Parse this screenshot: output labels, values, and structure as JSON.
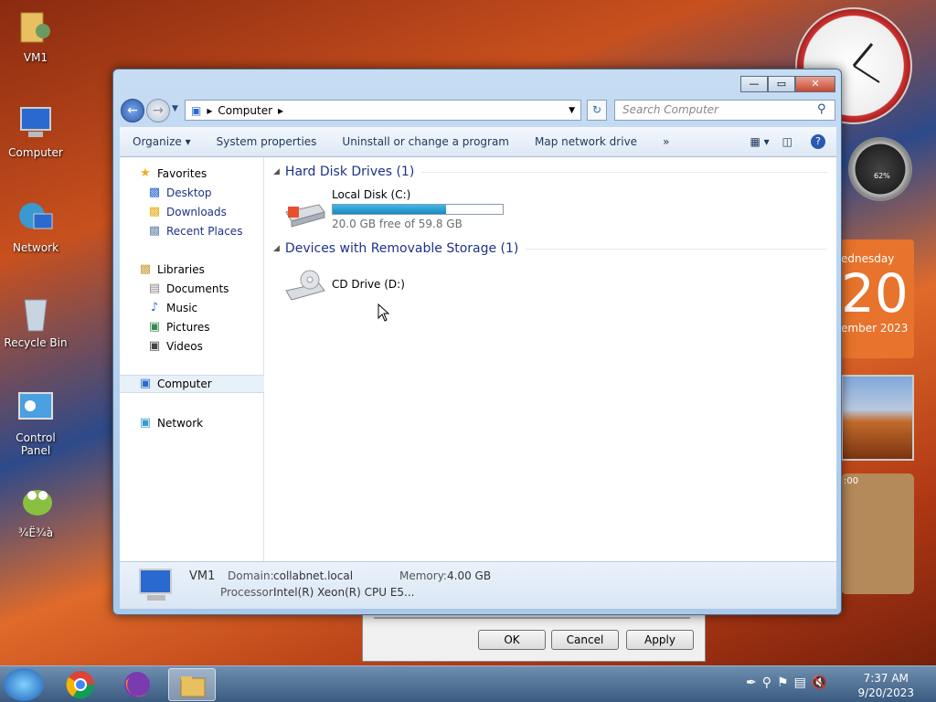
{
  "desktop_icons": [
    {
      "label": "VM1",
      "icon": "user-folder-icon"
    },
    {
      "label": "Computer",
      "icon": "computer-icon"
    },
    {
      "label": "Network",
      "icon": "network-icon"
    },
    {
      "label": "Recycle Bin",
      "icon": "recycle-bin-icon"
    },
    {
      "label": "Control Panel",
      "icon": "control-panel-icon"
    },
    {
      "label": "¾Ë¾à",
      "icon": "frog-app-icon"
    }
  ],
  "gadgets": {
    "meter_label": "62%",
    "calendar": {
      "day": "ednesday",
      "date": "20",
      "month": "ember 2023"
    },
    "puzzle_time": ":00"
  },
  "window": {
    "caption": {
      "minimize": "—",
      "maximize": "▭",
      "close": "✕"
    },
    "address": {
      "root_arrow": "▸",
      "location": "Computer",
      "trail_arrow": "▸"
    },
    "search_placeholder": "Search Computer",
    "toolbar": {
      "organize": "Organize",
      "system_properties": "System properties",
      "uninstall": "Uninstall or change a program",
      "map_drive": "Map network drive",
      "more": "»"
    },
    "nav": {
      "favorites": "Favorites",
      "desktop": "Desktop",
      "downloads": "Downloads",
      "recent": "Recent Places",
      "libraries": "Libraries",
      "documents": "Documents",
      "music": "Music",
      "pictures": "Pictures",
      "videos": "Videos",
      "computer": "Computer",
      "network": "Network"
    },
    "groups": {
      "hdd": "Hard Disk Drives (1)",
      "removable": "Devices with Removable Storage (1)"
    },
    "drives": {
      "c_name": "Local Disk (C:)",
      "c_free": "20.0 GB free of 59.8 GB",
      "c_used_fraction": 0.666,
      "d_name": "CD Drive (D:)"
    },
    "details": {
      "name": "VM1",
      "domain_label": "Domain:",
      "domain": "collabnet.local",
      "memory_label": "Memory:",
      "memory": "4.00 GB",
      "processor_label": "Processor:",
      "processor": "Intel(R) Xeon(R) CPU E5..."
    }
  },
  "bg_dialog": {
    "ok": "OK",
    "cancel": "Cancel",
    "apply": "Apply"
  },
  "taskbar": {
    "apps": [
      "chrome-icon",
      "firefox-icon",
      "explorer-icon"
    ],
    "time": "7:37 AM",
    "date": "9/20/2023"
  },
  "colors": {
    "accent": "#1e3287",
    "progress": "#26a0da",
    "taskbar": "#3a5a80"
  }
}
